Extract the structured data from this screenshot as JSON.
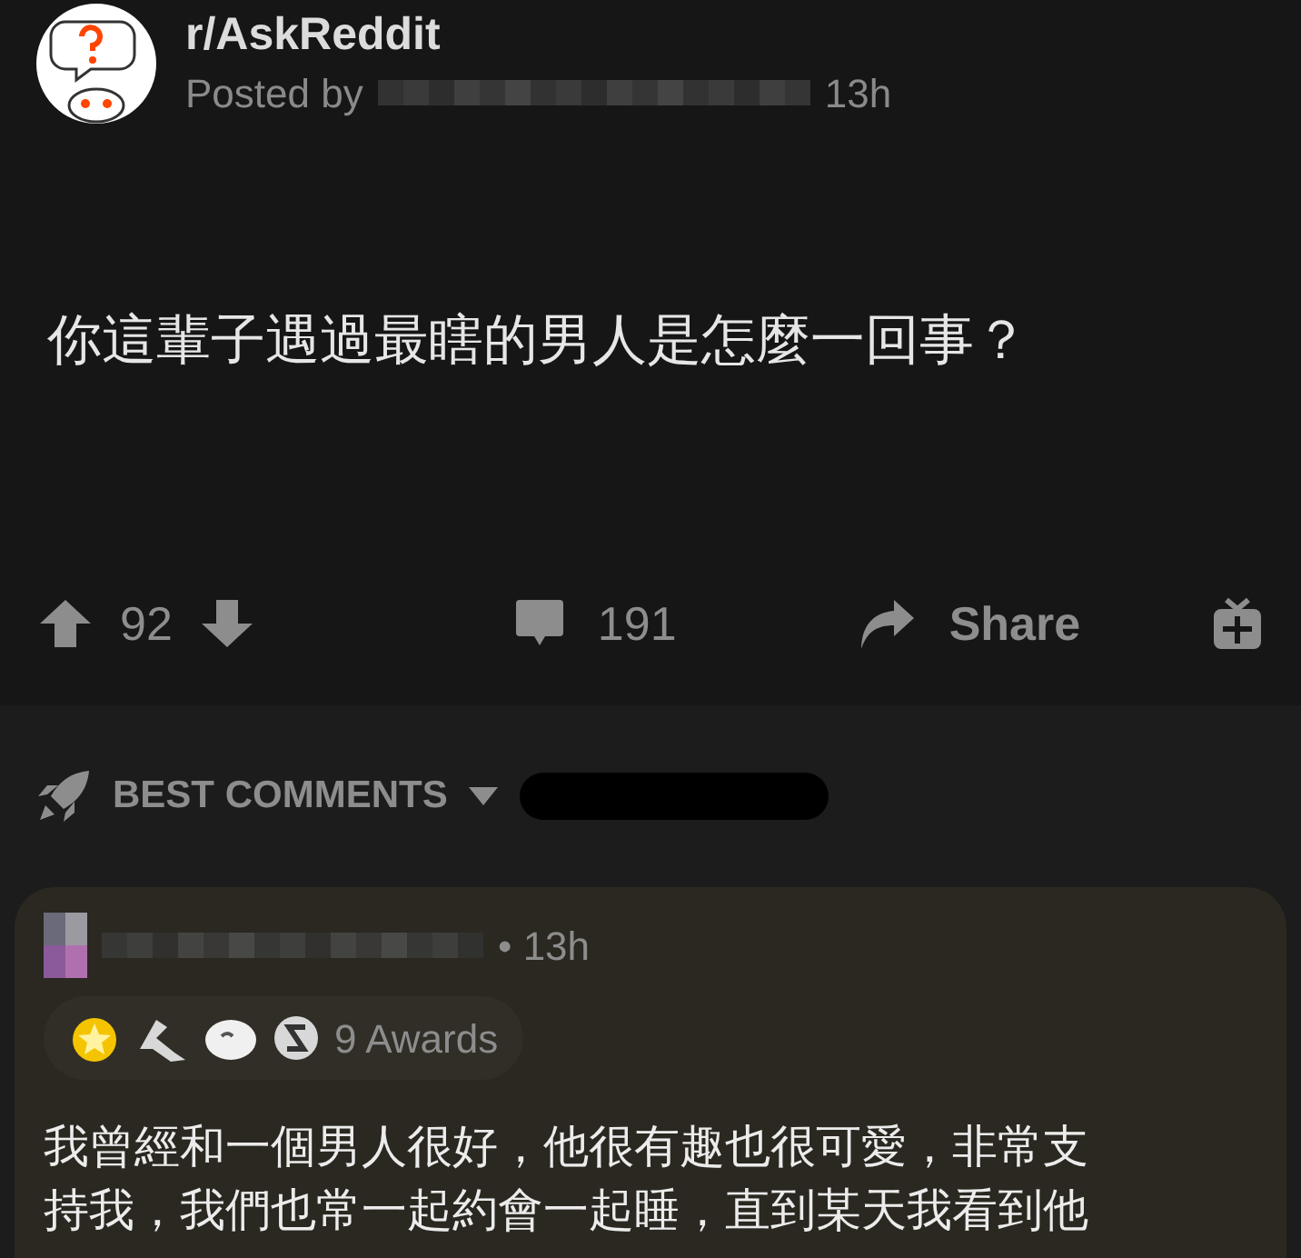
{
  "post": {
    "subreddit": "r/AskReddit",
    "posted_by": "Posted by",
    "time": "13h",
    "title": "你這輩子遇過最瞎的男人是怎麼一回事？"
  },
  "actions": {
    "score": "92",
    "comments": "191",
    "share": "Share"
  },
  "sort": {
    "label": "BEST COMMENTS"
  },
  "comment": {
    "time": "• 13h",
    "awards": "9 Awards",
    "lines": [
      "我曾經和一個男人很好，他很有趣也很可愛，非常支",
      "持我，我們也常一起約會一起睡，直到某天我看到他"
    ]
  }
}
